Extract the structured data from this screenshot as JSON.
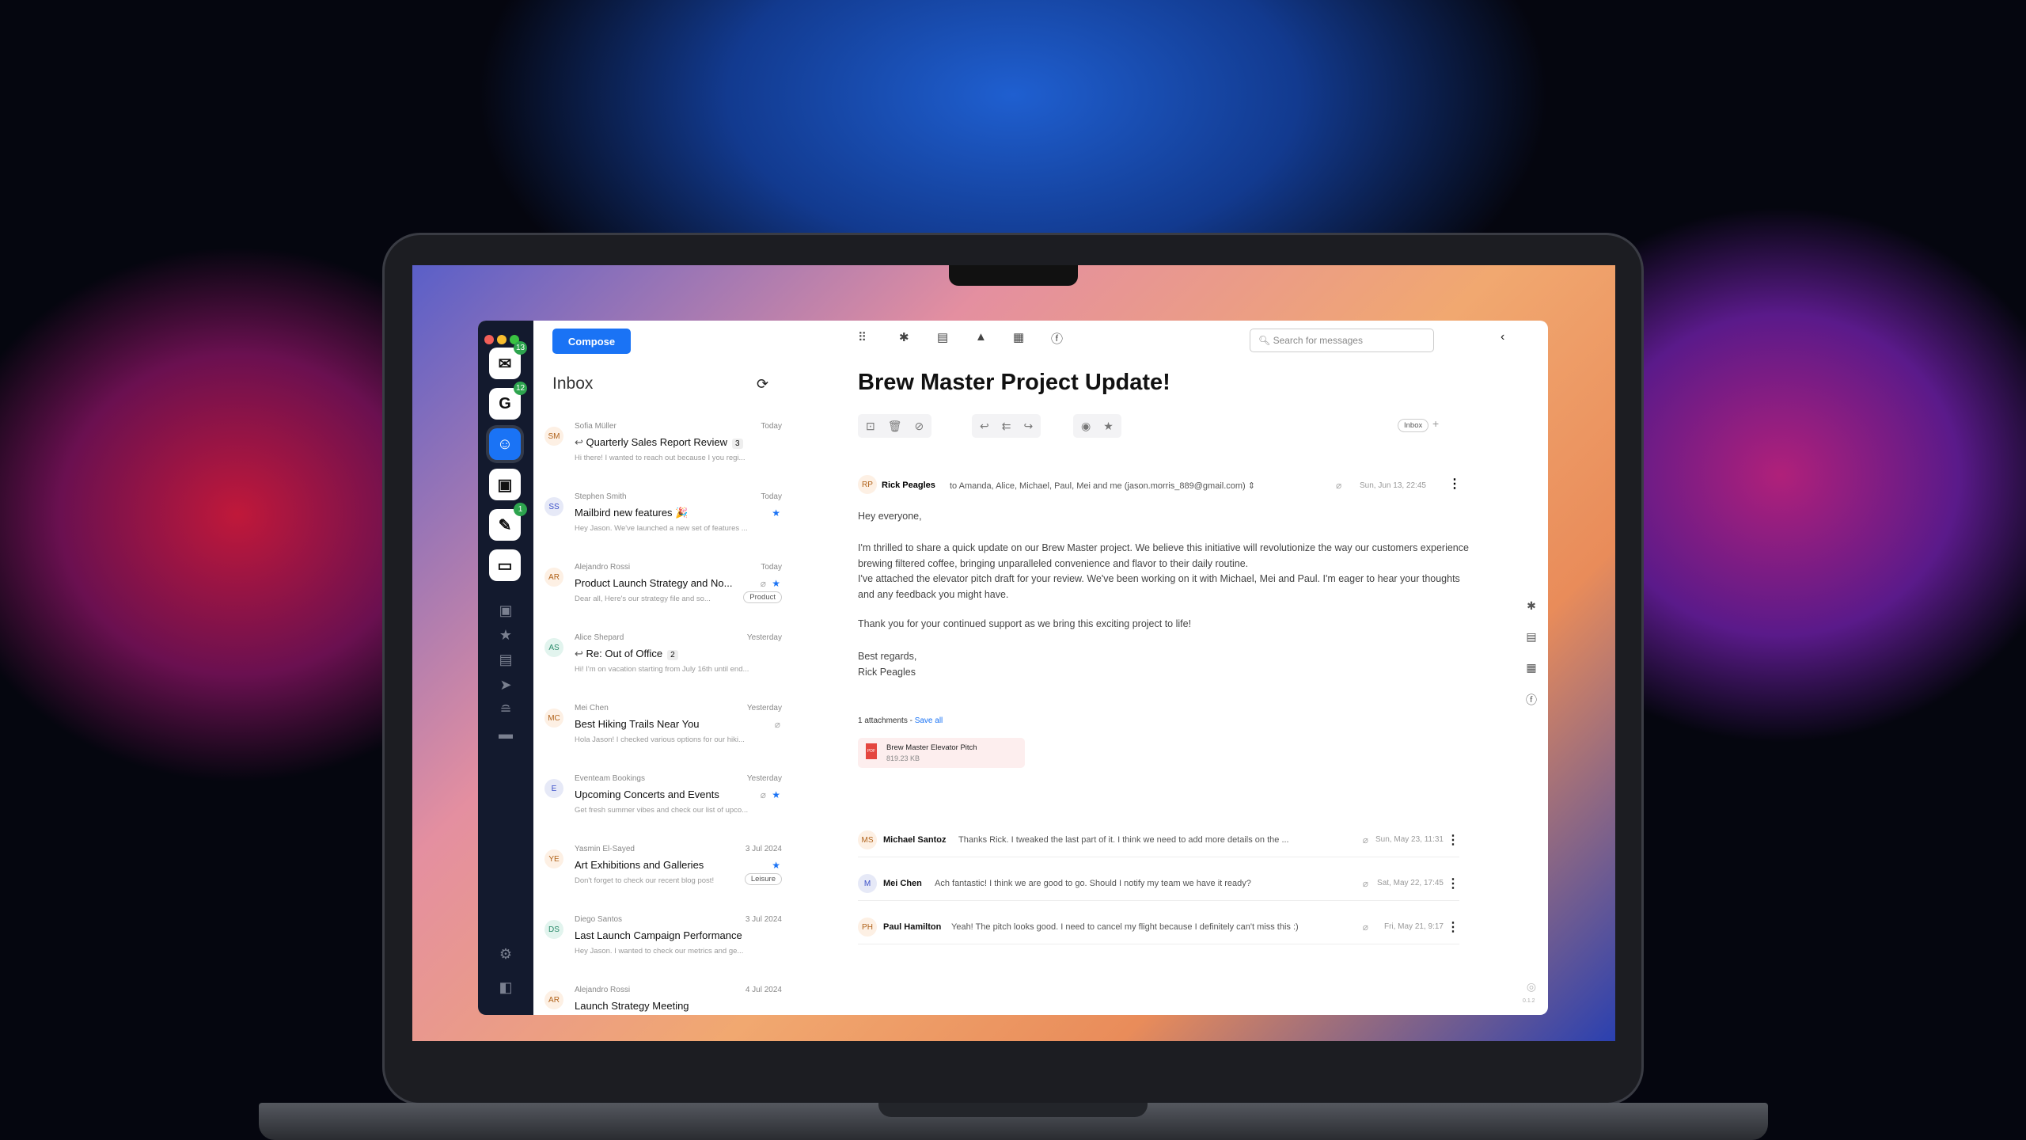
{
  "accounts": [
    {
      "name": "mail",
      "badge": "13"
    },
    {
      "name": "google",
      "badge": "12"
    },
    {
      "name": "avatar-active",
      "badge": ""
    },
    {
      "name": "inbox-app",
      "badge": ""
    },
    {
      "name": "tools",
      "badge": "1"
    },
    {
      "name": "work",
      "badge": ""
    }
  ],
  "list": {
    "compose": "Compose",
    "title": "Inbox",
    "items": [
      {
        "initials": "SM",
        "sender": "Sofia Müller",
        "date": "Today",
        "subject": "Quarterly Sales Report Review",
        "count": "3",
        "replied": true,
        "preview": "Hi there! I wanted to reach out because I you regi...",
        "star": false,
        "clip": false,
        "tag": "",
        "color": "#b0621a",
        "bg": "#fdf0e4"
      },
      {
        "initials": "SS",
        "sender": "Stephen Smith",
        "date": "Today",
        "subject": "Mailbird new features 🎉",
        "count": "",
        "replied": false,
        "preview": "Hey Jason. We've launched a new set of features ...",
        "star": true,
        "clip": false,
        "tag": "",
        "color": "#3b4fc8",
        "bg": "#e6e9f7"
      },
      {
        "initials": "AR",
        "sender": "Alejandro Rossi",
        "date": "Today",
        "subject": "Product Launch Strategy and No...",
        "count": "",
        "replied": false,
        "preview": "Dear all, Here's our strategy file and  so...",
        "star": true,
        "clip": true,
        "tag": "Product",
        "color": "#b0621a",
        "bg": "#fdf0e4"
      },
      {
        "initials": "AS",
        "sender": "Alice Shepard",
        "date": "Yesterday",
        "subject": "Re: Out of Office",
        "count": "2",
        "replied": true,
        "preview": "Hi! I'm on vacation starting from July 16th until end...",
        "star": false,
        "clip": false,
        "tag": "",
        "color": "#2a8a6a",
        "bg": "#e2f4ee"
      },
      {
        "initials": "MC",
        "sender": "Mei Chen",
        "date": "Yesterday",
        "subject": "Best Hiking Trails Near You",
        "count": "",
        "replied": false,
        "preview": "Hola Jason! I checked various options for our hiki...",
        "star": false,
        "clip": true,
        "tag": "",
        "color": "#b0621a",
        "bg": "#fdf0e4"
      },
      {
        "initials": "E",
        "sender": "Eventeam Bookings",
        "date": "Yesterday",
        "subject": "Upcoming Concerts and Events",
        "count": "",
        "replied": false,
        "preview": "Get fresh summer vibes and check our list of upco...",
        "star": true,
        "clip": true,
        "tag": "",
        "color": "#3b4fc8",
        "bg": "#e6e9f7"
      },
      {
        "initials": "YE",
        "sender": "Yasmin El-Sayed",
        "date": "3 Jul 2024",
        "subject": "Art Exhibitions and Galleries",
        "count": "",
        "replied": false,
        "preview": "Don't forget to check our recent blog post!",
        "star": true,
        "clip": false,
        "tag": "Leisure",
        "color": "#b0621a",
        "bg": "#fdf0e4"
      },
      {
        "initials": "DS",
        "sender": "Diego Santos",
        "date": "3 Jul 2024",
        "subject": "Last Launch Campaign Performance",
        "count": "",
        "replied": false,
        "preview": "Hey Jason. I wanted to check our metrics and ge...",
        "star": false,
        "clip": false,
        "tag": "",
        "color": "#2a8a6a",
        "bg": "#e2f4ee"
      },
      {
        "initials": "AR",
        "sender": "Alejandro Rossi",
        "date": "4 Jul 2024",
        "subject": "Launch Strategy Meeting",
        "count": "",
        "replied": false,
        "preview": "",
        "star": false,
        "clip": false,
        "tag": "",
        "color": "#b0621a",
        "bg": "#fdf0e4"
      }
    ]
  },
  "main": {
    "search_placeholder": "Search for messages",
    "title": "Brew Master Project Update!",
    "label": "Inbox",
    "message": {
      "initials": "RP",
      "sender": "Rick Peagles",
      "to": "to Amanda, Alice, Michael, Paul, Mei and me (jason.morris_889@gmail.com)",
      "date": "Sun, Jun 13, 22:45",
      "body": [
        "Hey everyone,",
        "I'm thrilled to share a quick update on our Brew Master project. We believe this initiative will revolutionize the way our customers experience brewing filtered coffee, bringing unparalleled convenience and flavor to their daily routine.",
        "I've attached the elevator pitch draft for your review. We've been working on it with Michael, Mei and Paul. I'm eager to hear your thoughts and any feedback you might have.",
        "Thank you for your continued support as we bring this exciting project to life!",
        "Best regards,",
        "Rick Peagles"
      ],
      "attachments_label": "1 attachments -",
      "save_all": "Save all",
      "attachment": {
        "name": "Brew Master Elevator Pitch",
        "size": "819.23 KB",
        "type": "PDF"
      }
    },
    "threads": [
      {
        "initials": "MS",
        "name": "Michael Santoz",
        "preview": "Thanks Rick. I tweaked the last part of it. I think we need to add more details on the ...",
        "date": "Sun, May 23, 11:31",
        "color": "#b0621a",
        "bg": "#fdf0e4"
      },
      {
        "initials": "M",
        "name": "Mei Chen",
        "preview": "Ach fantastic! I think we are good to go. Should I notify my team we have it ready?",
        "date": "Sat, May 22, 17:45",
        "color": "#3b4fc8",
        "bg": "#e6e9f7"
      },
      {
        "initials": "PH",
        "name": "Paul Hamilton",
        "preview": "Yeah! The pitch looks good. I need to cancel my flight because I definitely can't miss this :)",
        "date": "Fri, May 21, 9:17",
        "color": "#b0621a",
        "bg": "#fdf0e4"
      }
    ]
  },
  "version": "0.1.2"
}
